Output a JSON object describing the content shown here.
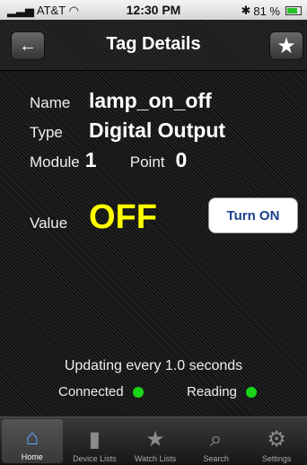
{
  "status": {
    "carrier": "AT&T",
    "time": "12:30 PM",
    "battery": "81 %"
  },
  "nav": {
    "title": "Tag Details"
  },
  "tag": {
    "name_label": "Name",
    "name": "lamp_on_off",
    "type_label": "Type",
    "type": "Digital Output",
    "module_label": "Module",
    "module": "1",
    "point_label": "Point",
    "point": "0",
    "value_label": "Value",
    "value": "OFF",
    "value_color": "#ffff00",
    "toggle_label": "Turn ON"
  },
  "footer": {
    "updating": "Updating every 1.0 seconds",
    "connected_label": "Connected",
    "reading_label": "Reading",
    "indicator_color": "#18d618"
  },
  "tabs": [
    {
      "label": "Home",
      "icon": "home-icon",
      "active": true
    },
    {
      "label": "Device Lists",
      "icon": "document-icon",
      "active": false
    },
    {
      "label": "Watch Lists",
      "icon": "star-icon",
      "active": false
    },
    {
      "label": "Search",
      "icon": "search-icon",
      "active": false
    },
    {
      "label": "Settings",
      "icon": "gear-icon",
      "active": false
    }
  ]
}
